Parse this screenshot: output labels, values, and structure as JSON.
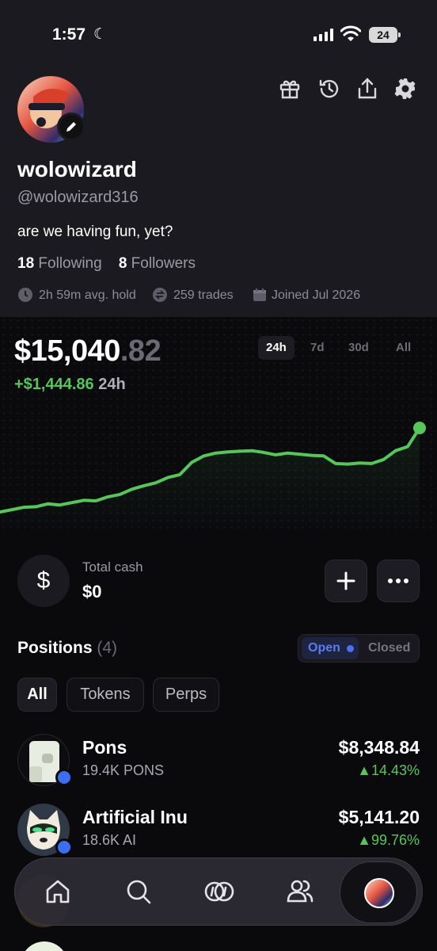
{
  "status": {
    "time": "1:57",
    "battery": "24"
  },
  "profile": {
    "name": "wolowizard",
    "handle": "@wolowizard316",
    "bio": "are we having fun, yet?",
    "following_count": "18",
    "following_label": "Following",
    "followers_count": "8",
    "followers_label": "Followers",
    "avg_hold": "2h 59m avg. hold",
    "trades": "259 trades",
    "joined": "Joined Jul 2026"
  },
  "portfolio": {
    "value_main": "$15,040",
    "value_cents": ".82",
    "change": "+$1,444.86",
    "change_period": "24h",
    "ranges": [
      "24h",
      "7d",
      "30d",
      "All"
    ],
    "active_range": "24h"
  },
  "chart_data": {
    "type": "line",
    "title": "",
    "x": [
      0,
      1,
      2,
      3,
      4,
      5,
      6,
      7,
      8,
      9,
      10,
      11,
      12,
      13,
      14,
      15,
      16,
      17,
      18,
      19,
      20,
      21,
      22,
      23,
      24,
      25,
      26,
      27,
      28,
      29,
      30,
      31,
      32,
      33,
      34,
      35
    ],
    "values": [
      13600,
      13640,
      13680,
      13690,
      13740,
      13720,
      13760,
      13800,
      13790,
      13860,
      13900,
      13990,
      14050,
      14100,
      14190,
      14240,
      14450,
      14560,
      14610,
      14630,
      14640,
      14650,
      14620,
      14580,
      14610,
      14590,
      14570,
      14560,
      14430,
      14420,
      14440,
      14430,
      14500,
      14650,
      14720,
      15040
    ],
    "color": "#57c65a",
    "grid": false,
    "xlabel": "",
    "ylabel": ""
  },
  "cash": {
    "label": "Total cash",
    "value": "$0"
  },
  "positions": {
    "title": "Positions",
    "count": "(4)",
    "open_label": "Open",
    "closed_label": "Closed",
    "filters": [
      "All",
      "Tokens",
      "Perps"
    ],
    "items": [
      {
        "name": "Pons",
        "amount": "19.4K PONS",
        "value": "$8,348.84",
        "change": "▲14.43%"
      },
      {
        "name": "Artificial Inu",
        "amount": "18.6K AI",
        "value": "$5,141.20",
        "change": "▲99.76%"
      }
    ]
  },
  "nav": {
    "items": [
      "home-icon",
      "search-icon",
      "trade-icon",
      "people-icon",
      "profile-avatar"
    ]
  }
}
